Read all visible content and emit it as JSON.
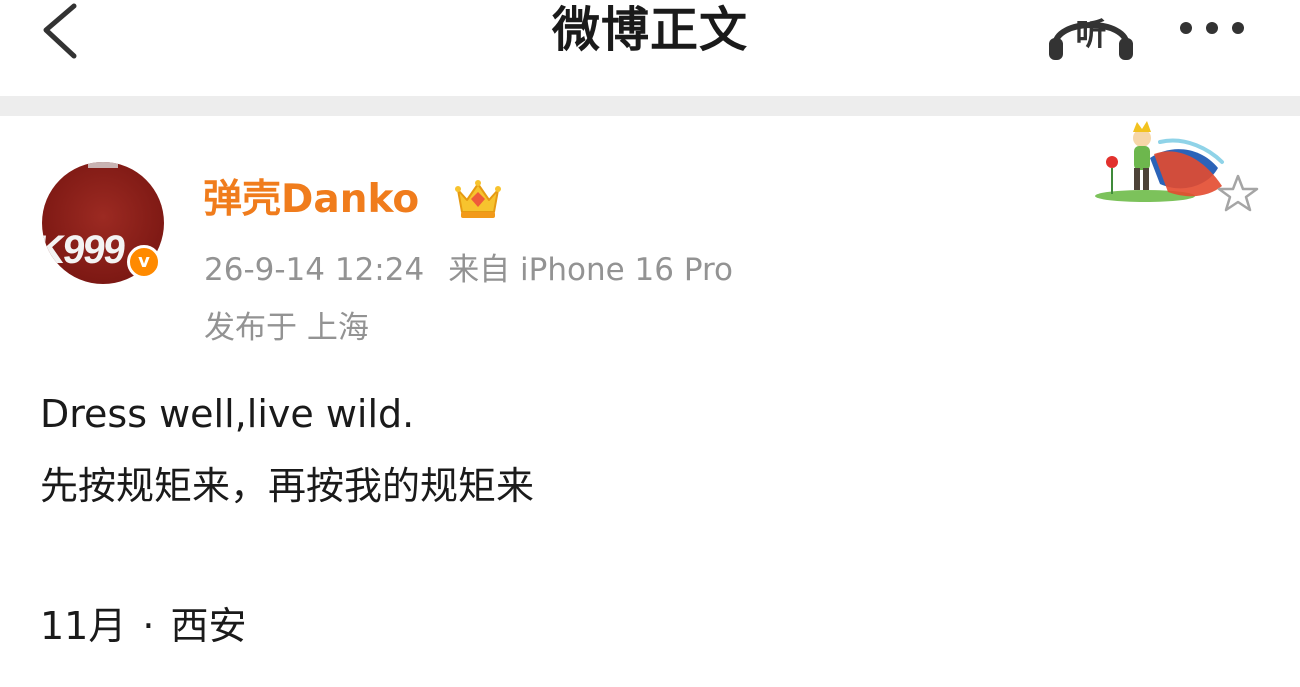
{
  "header": {
    "title": "微博正文",
    "listen_label": "听"
  },
  "post": {
    "author": {
      "name": "弹壳Danko",
      "avatar_text": "K999",
      "badge": "v"
    },
    "meta": {
      "time": "26-9-14 12:24",
      "source": "来自 iPhone 16 Pro",
      "location": "发布于 上海"
    },
    "content": {
      "line1": "Dress well,live wild.",
      "line2": "先按规矩来，再按我的规矩来",
      "tail_date": "11月",
      "tail_sep": "·",
      "tail_place": "西安"
    }
  },
  "colors": {
    "accent_name": "#f07c1c",
    "verified": "#ff8a00",
    "meta_text": "#939393",
    "separator": "#ededed",
    "avatar_bg": "#7e1914"
  },
  "icons": {
    "back": "chevron-left-icon",
    "listen": "headphones-icon",
    "more": "more-dots-icon",
    "crown": "crown-icon",
    "favorite": "star-icon"
  }
}
